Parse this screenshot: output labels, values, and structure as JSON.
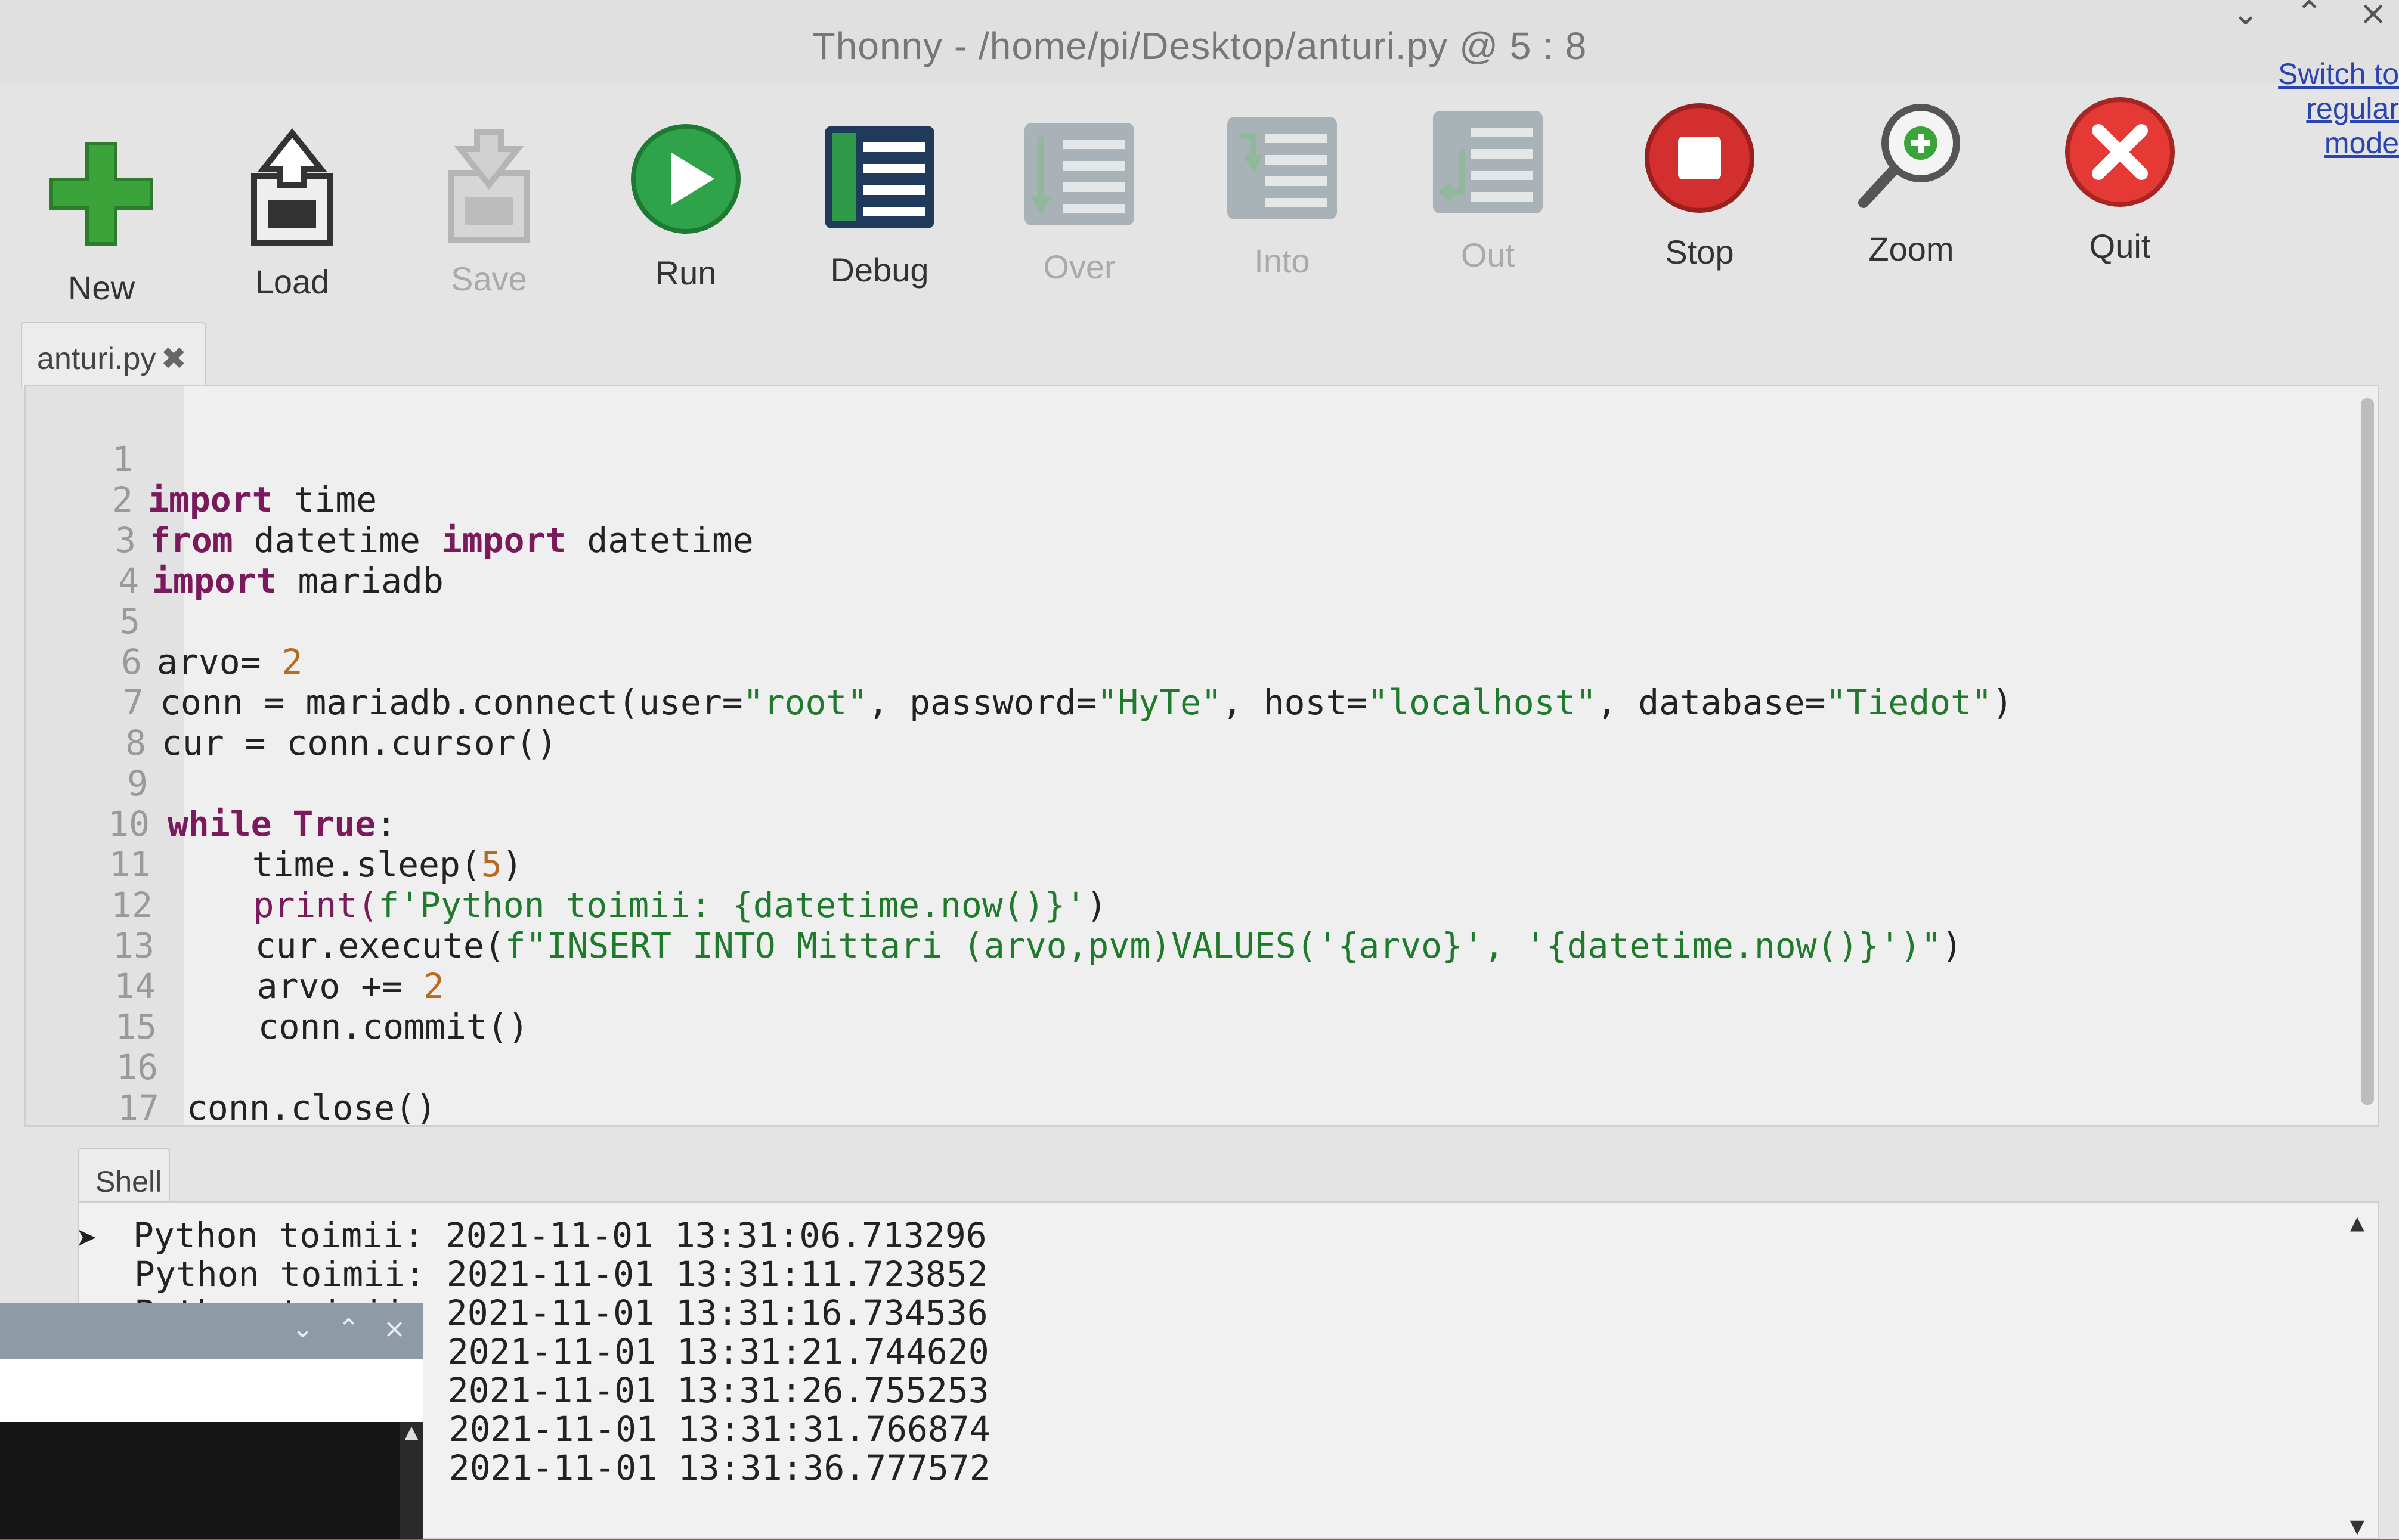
{
  "window": {
    "title": "Thonny  -  /home/pi/Desktop/anturi.py  @  5 : 8",
    "controls": {
      "minimize": "⌄",
      "maximize": "⌃",
      "close": "×"
    }
  },
  "toolbar": {
    "buttons": [
      {
        "id": "new",
        "label": "New",
        "icon": "new-file-icon",
        "enabled": true,
        "color": "#3aa33a"
      },
      {
        "id": "load",
        "label": "Load",
        "icon": "load-icon",
        "enabled": true
      },
      {
        "id": "save",
        "label": "Save",
        "icon": "save-icon",
        "enabled": false
      },
      {
        "id": "run",
        "label": "Run",
        "icon": "run-icon",
        "enabled": true,
        "color": "#2fa34a"
      },
      {
        "id": "debug",
        "label": "Debug",
        "icon": "debug-icon",
        "enabled": true,
        "color": "#1f3a5a"
      },
      {
        "id": "over",
        "label": "Over",
        "icon": "step-over-icon",
        "enabled": false
      },
      {
        "id": "into",
        "label": "Into",
        "icon": "step-into-icon",
        "enabled": false
      },
      {
        "id": "out",
        "label": "Out",
        "icon": "step-out-icon",
        "enabled": false
      },
      {
        "id": "stop",
        "label": "Stop",
        "icon": "stop-icon",
        "enabled": true,
        "color": "#d32f2f"
      },
      {
        "id": "zoom",
        "label": "Zoom",
        "icon": "zoom-icon",
        "enabled": true
      },
      {
        "id": "quit",
        "label": "Quit",
        "icon": "quit-icon",
        "enabled": true,
        "color": "#e53935"
      }
    ],
    "switch_mode": {
      "line1": "Switch to",
      "line2": "regular",
      "line3": "mode"
    }
  },
  "editor": {
    "tab_label": "anturi.py",
    "tab_close": "✖",
    "lines": [
      {
        "n": "1"
      },
      {
        "n": "2"
      },
      {
        "n": "3"
      },
      {
        "n": "4"
      },
      {
        "n": "5"
      },
      {
        "n": "6"
      },
      {
        "n": "7"
      },
      {
        "n": "8"
      },
      {
        "n": "9"
      },
      {
        "n": "10"
      },
      {
        "n": "11"
      },
      {
        "n": "12"
      },
      {
        "n": "13"
      },
      {
        "n": "14"
      },
      {
        "n": "15"
      },
      {
        "n": "16"
      },
      {
        "n": "17"
      }
    ],
    "code": {
      "l1_kw": "import",
      "l1_rest": " time",
      "l2_kw1": "from",
      "l2_mid": " datetime ",
      "l2_kw2": "import",
      "l2_rest": " datetime",
      "l3_kw": "import",
      "l3_rest": " mariadb",
      "l5_a": "arvo= ",
      "l5_num": "2",
      "l6_a": "conn = mariadb.connect(user=",
      "l6_s1": "\"root\"",
      "l6_b": ", password=",
      "l6_s2": "\"HyTe\"",
      "l6_c": ", host=",
      "l6_s3": "\"localhost\"",
      "l6_d": ", database=",
      "l6_s4": "\"Tiedot\"",
      "l6_e": ")",
      "l7": "cur = conn.cursor()",
      "l9_kw1": "while",
      "l9_sp": " ",
      "l9_kw2": "True",
      "l9_rest": ":",
      "l10_a": "    time.sleep(",
      "l10_num": "5",
      "l10_b": ")",
      "l11_a": "    print(",
      "l11_s": "f'Python toimii: {datetime.now()}'",
      "l11_b": ")",
      "l12_a": "    cur.execute(",
      "l12_s": "f\"INSERT INTO Mittari (arvo,pvm)VALUES('{arvo}', '{datetime.now()}')\"",
      "l12_b": ")",
      "l13_a": "    arvo += ",
      "l13_num": "2",
      "l14": "    conn.commit()",
      "l16": "conn.close()"
    }
  },
  "shell": {
    "tab_label": "Shell",
    "lines": [
      "Python toimii: 2021-11-01 13:31:06.713296",
      "Python toimii: 2021-11-01 13:31:11.723852",
      "Python toimii: 2021-11-01 13:31:16.734536",
      "Python toimii: 2021-11-01 13:31:21.744620",
      "Python toimii: 2021-11-01 13:31:26.755253",
      "Python toimii: 2021-11-01 13:31:31.766874",
      "Python toimii: 2021-11-01 13:31:36.777572"
    ]
  },
  "overlay_window": {
    "controls": {
      "minimize": "⌄",
      "maximize": "⌃",
      "close": "×"
    }
  }
}
